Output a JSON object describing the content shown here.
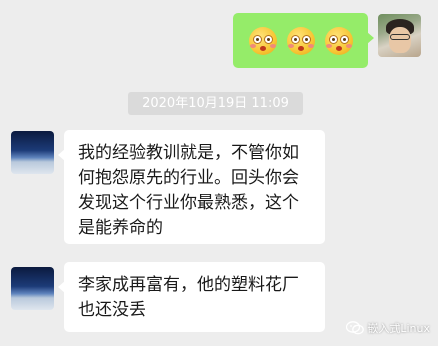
{
  "chat": {
    "timestamp": "2020年10月19日 11:09",
    "outgoing": {
      "emojis": [
        "flushed-face-emoji",
        "flushed-face-emoji",
        "flushed-face-emoji"
      ]
    },
    "incoming": [
      {
        "lines": [
          "我的经验教训就是，不管你如",
          "何抱怨原先的行业。回头你会",
          "发现这个行业你最熟悉，这个",
          "是能养命的"
        ]
      },
      {
        "lines": [
          "李家成再富有，他的塑料花厂",
          "也还没丢"
        ]
      }
    ]
  },
  "watermark": {
    "text": "嵌入式Linux",
    "icon": "wechat-icon"
  },
  "colors": {
    "background": "#ededed",
    "outgoing_bubble": "#95ec69",
    "incoming_bubble": "#ffffff",
    "timestamp_bg": "#dadada"
  }
}
